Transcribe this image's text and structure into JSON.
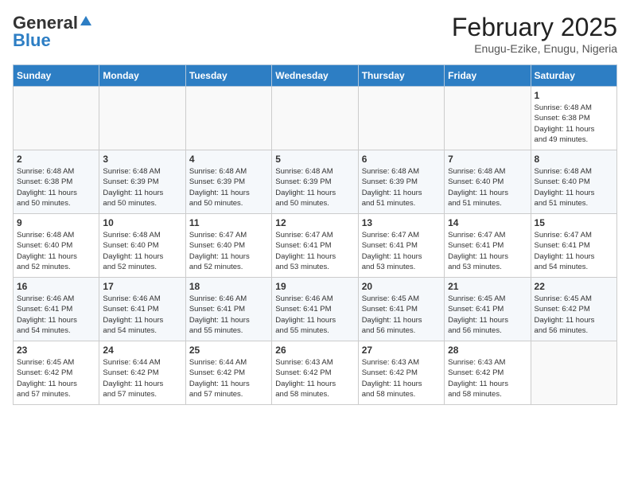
{
  "header": {
    "logo_general": "General",
    "logo_blue": "Blue",
    "month_year": "February 2025",
    "location": "Enugu-Ezike, Enugu, Nigeria"
  },
  "weekdays": [
    "Sunday",
    "Monday",
    "Tuesday",
    "Wednesday",
    "Thursday",
    "Friday",
    "Saturday"
  ],
  "weeks": [
    [
      {
        "day": "",
        "info": ""
      },
      {
        "day": "",
        "info": ""
      },
      {
        "day": "",
        "info": ""
      },
      {
        "day": "",
        "info": ""
      },
      {
        "day": "",
        "info": ""
      },
      {
        "day": "",
        "info": ""
      },
      {
        "day": "1",
        "info": "Sunrise: 6:48 AM\nSunset: 6:38 PM\nDaylight: 11 hours\nand 49 minutes."
      }
    ],
    [
      {
        "day": "2",
        "info": "Sunrise: 6:48 AM\nSunset: 6:38 PM\nDaylight: 11 hours\nand 50 minutes."
      },
      {
        "day": "3",
        "info": "Sunrise: 6:48 AM\nSunset: 6:39 PM\nDaylight: 11 hours\nand 50 minutes."
      },
      {
        "day": "4",
        "info": "Sunrise: 6:48 AM\nSunset: 6:39 PM\nDaylight: 11 hours\nand 50 minutes."
      },
      {
        "day": "5",
        "info": "Sunrise: 6:48 AM\nSunset: 6:39 PM\nDaylight: 11 hours\nand 50 minutes."
      },
      {
        "day": "6",
        "info": "Sunrise: 6:48 AM\nSunset: 6:39 PM\nDaylight: 11 hours\nand 51 minutes."
      },
      {
        "day": "7",
        "info": "Sunrise: 6:48 AM\nSunset: 6:40 PM\nDaylight: 11 hours\nand 51 minutes."
      },
      {
        "day": "8",
        "info": "Sunrise: 6:48 AM\nSunset: 6:40 PM\nDaylight: 11 hours\nand 51 minutes."
      }
    ],
    [
      {
        "day": "9",
        "info": "Sunrise: 6:48 AM\nSunset: 6:40 PM\nDaylight: 11 hours\nand 52 minutes."
      },
      {
        "day": "10",
        "info": "Sunrise: 6:48 AM\nSunset: 6:40 PM\nDaylight: 11 hours\nand 52 minutes."
      },
      {
        "day": "11",
        "info": "Sunrise: 6:47 AM\nSunset: 6:40 PM\nDaylight: 11 hours\nand 52 minutes."
      },
      {
        "day": "12",
        "info": "Sunrise: 6:47 AM\nSunset: 6:41 PM\nDaylight: 11 hours\nand 53 minutes."
      },
      {
        "day": "13",
        "info": "Sunrise: 6:47 AM\nSunset: 6:41 PM\nDaylight: 11 hours\nand 53 minutes."
      },
      {
        "day": "14",
        "info": "Sunrise: 6:47 AM\nSunset: 6:41 PM\nDaylight: 11 hours\nand 53 minutes."
      },
      {
        "day": "15",
        "info": "Sunrise: 6:47 AM\nSunset: 6:41 PM\nDaylight: 11 hours\nand 54 minutes."
      }
    ],
    [
      {
        "day": "16",
        "info": "Sunrise: 6:46 AM\nSunset: 6:41 PM\nDaylight: 11 hours\nand 54 minutes."
      },
      {
        "day": "17",
        "info": "Sunrise: 6:46 AM\nSunset: 6:41 PM\nDaylight: 11 hours\nand 54 minutes."
      },
      {
        "day": "18",
        "info": "Sunrise: 6:46 AM\nSunset: 6:41 PM\nDaylight: 11 hours\nand 55 minutes."
      },
      {
        "day": "19",
        "info": "Sunrise: 6:46 AM\nSunset: 6:41 PM\nDaylight: 11 hours\nand 55 minutes."
      },
      {
        "day": "20",
        "info": "Sunrise: 6:45 AM\nSunset: 6:41 PM\nDaylight: 11 hours\nand 56 minutes."
      },
      {
        "day": "21",
        "info": "Sunrise: 6:45 AM\nSunset: 6:41 PM\nDaylight: 11 hours\nand 56 minutes."
      },
      {
        "day": "22",
        "info": "Sunrise: 6:45 AM\nSunset: 6:42 PM\nDaylight: 11 hours\nand 56 minutes."
      }
    ],
    [
      {
        "day": "23",
        "info": "Sunrise: 6:45 AM\nSunset: 6:42 PM\nDaylight: 11 hours\nand 57 minutes."
      },
      {
        "day": "24",
        "info": "Sunrise: 6:44 AM\nSunset: 6:42 PM\nDaylight: 11 hours\nand 57 minutes."
      },
      {
        "day": "25",
        "info": "Sunrise: 6:44 AM\nSunset: 6:42 PM\nDaylight: 11 hours\nand 57 minutes."
      },
      {
        "day": "26",
        "info": "Sunrise: 6:43 AM\nSunset: 6:42 PM\nDaylight: 11 hours\nand 58 minutes."
      },
      {
        "day": "27",
        "info": "Sunrise: 6:43 AM\nSunset: 6:42 PM\nDaylight: 11 hours\nand 58 minutes."
      },
      {
        "day": "28",
        "info": "Sunrise: 6:43 AM\nSunset: 6:42 PM\nDaylight: 11 hours\nand 58 minutes."
      },
      {
        "day": "",
        "info": ""
      }
    ]
  ]
}
